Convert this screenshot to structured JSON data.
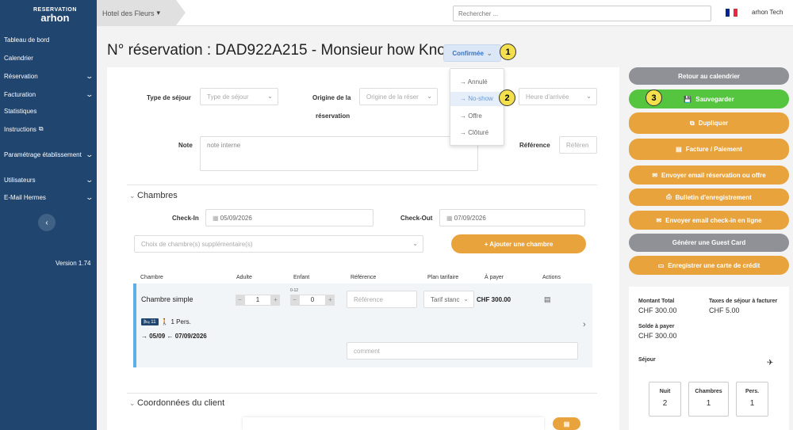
{
  "app": {
    "logo_top": "RESERVATION",
    "logo_name": "arhon",
    "version": "Version 1.74"
  },
  "sidebar": {
    "items": [
      {
        "label": "Tableau de bord",
        "chevron": false
      },
      {
        "label": "Calendrier",
        "chevron": false
      },
      {
        "label": "Réservation",
        "chevron": true
      },
      {
        "label": "Facturation",
        "chevron": true
      },
      {
        "label": "Statistiques",
        "chevron": false
      },
      {
        "label": "Instructions",
        "chevron": false
      },
      {
        "label": "Paramétrage établissement",
        "chevron": true
      },
      {
        "label": "Utilisateurs",
        "chevron": true
      },
      {
        "label": "E-Mail Hermes",
        "chevron": true
      }
    ]
  },
  "topbar": {
    "hotel": "Hotel des Fleurs",
    "search_placeholder": "Rechercher ...",
    "user": "arhon Tech",
    "flag_colors": [
      "#002395",
      "#ffffff",
      "#ed2939"
    ]
  },
  "page": {
    "title": "N° réservation : DAD922A215 - Monsieur how Know",
    "status": "Confirmée"
  },
  "dropdown": {
    "items": [
      "→ Annulé",
      "→ No-show",
      "→ Offre",
      "→ Clôturé"
    ]
  },
  "badges": [
    "1",
    "2",
    "3"
  ],
  "form": {
    "type_sejour_label": "Type de séjour",
    "type_sejour_placeholder": "Type de séjour",
    "origine_label_1": "Origine de la",
    "origine_label_2": "réservation",
    "origine_placeholder": "Origine de la réser",
    "heure_placeholder": "Heure d'arrivée",
    "note_label": "Note",
    "note_placeholder": "note interne",
    "reference_label": "Référence",
    "reference_placeholder": "Référen"
  },
  "chambres": {
    "title": "Chambres",
    "checkin_label": "Check-In",
    "checkin": "05/09/2026",
    "checkout_label": "Check-Out",
    "checkout": "07/09/2026",
    "choice_placeholder": "Choix de chambre(s) supplémentaire(s)",
    "add_button": "+ Ajouter une chambre",
    "columns": [
      "Chambre",
      "Adulte",
      "Enfant",
      "Référence",
      "Plan tarifaire",
      "À payer",
      "Actions"
    ],
    "row": {
      "name": "Chambre simple",
      "adults": "1",
      "children_ages": "0-12",
      "children": "0",
      "reference_placeholder": "Référence",
      "plan": "Tarif stanc",
      "price": "CHF 300.00",
      "bed": "11",
      "persons": "1 Pers.",
      "dates": "05/09 ← 07/09/2026",
      "comment_placeholder": "comment"
    }
  },
  "client": {
    "title": "Coordonnées du client"
  },
  "actions": [
    {
      "label": "Retour au calendrier",
      "color": "#8f9196"
    },
    {
      "label": "Sauvegarder",
      "color": "#55c43f"
    },
    {
      "label": "Dupliquer",
      "color": "#e8a33d"
    },
    {
      "label": "Facture / Paiement",
      "color": "#e8a33d"
    },
    {
      "label": "Envoyer email réservation ou offre",
      "color": "#e8a33d"
    },
    {
      "label": "Bulletin d'enregistrement",
      "color": "#e8a33d"
    },
    {
      "label": "Envoyer email check-in en ligne",
      "color": "#e8a33d"
    },
    {
      "label": "Générer une Guest Card",
      "color": "#8f9196"
    },
    {
      "label": "Enregistrer une carte de crédit",
      "color": "#e8a33d"
    }
  ],
  "summary": {
    "montant_label": "Montant Total",
    "montant": "CHF 300.00",
    "taxes_label": "Taxes de séjour à facturer",
    "taxes": "CHF 5.00",
    "solde_label": "Solde à payer",
    "solde": "CHF 300.00",
    "sejour_label": "Séjour",
    "nuit_label": "Nuit",
    "nuit": "2",
    "chambres_label": "Chambres",
    "chambres": "1",
    "pers_label": "Pers.",
    "pers": "1"
  }
}
